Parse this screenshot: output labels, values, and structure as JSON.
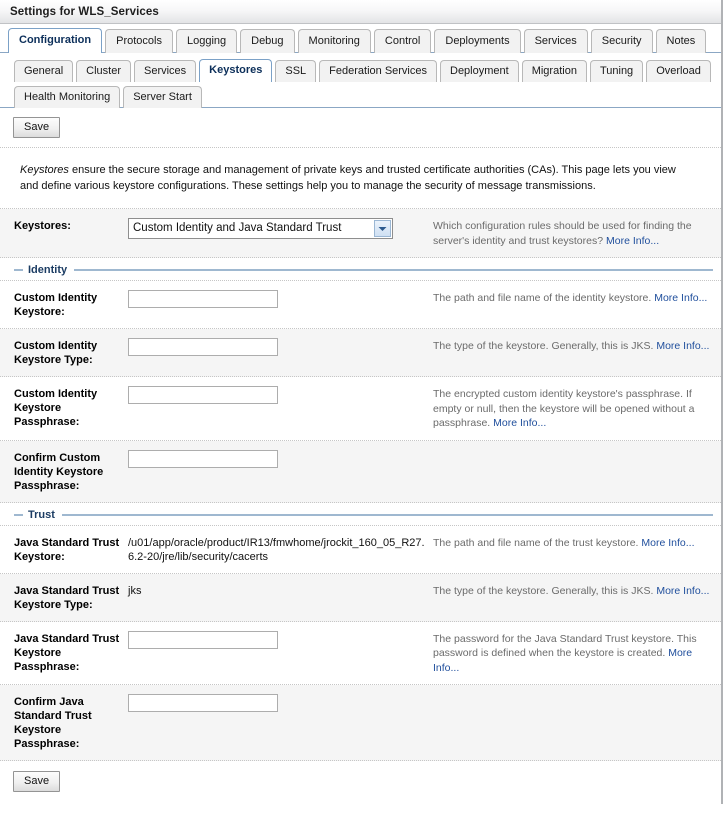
{
  "header": {
    "title": "Settings for WLS_Services"
  },
  "tabs_level1": [
    {
      "label": "Configuration",
      "active": true
    },
    {
      "label": "Protocols",
      "active": false
    },
    {
      "label": "Logging",
      "active": false
    },
    {
      "label": "Debug",
      "active": false
    },
    {
      "label": "Monitoring",
      "active": false
    },
    {
      "label": "Control",
      "active": false
    },
    {
      "label": "Deployments",
      "active": false
    },
    {
      "label": "Services",
      "active": false
    },
    {
      "label": "Security",
      "active": false
    },
    {
      "label": "Notes",
      "active": false
    }
  ],
  "tabs_level2": [
    {
      "label": "General",
      "active": false
    },
    {
      "label": "Cluster",
      "active": false
    },
    {
      "label": "Services",
      "active": false
    },
    {
      "label": "Keystores",
      "active": true
    },
    {
      "label": "SSL",
      "active": false
    },
    {
      "label": "Federation Services",
      "active": false
    },
    {
      "label": "Deployment",
      "active": false
    },
    {
      "label": "Migration",
      "active": false
    },
    {
      "label": "Tuning",
      "active": false
    },
    {
      "label": "Overload",
      "active": false
    }
  ],
  "tabs_level3": [
    {
      "label": "Health Monitoring",
      "active": false
    },
    {
      "label": "Server Start",
      "active": false
    }
  ],
  "toolbar": {
    "save_top_label": "Save",
    "save_bottom_label": "Save"
  },
  "intro": {
    "emphasis": "Keystores",
    "text": " ensure the secure storage and management of private keys and trusted certificate authorities (CAs). This page lets you view and define various keystore configurations. These settings help you to manage the security of message transmissions."
  },
  "keystores_row": {
    "label": "Keystores:",
    "selected": "Custom Identity and Java Standard Trust",
    "help": "Which configuration rules should be used for finding the server's identity and trust keystores?",
    "more_info": "More Info..."
  },
  "sections": {
    "identity": "Identity",
    "trust": "Trust"
  },
  "identity_rows": [
    {
      "label": "Custom Identity Keystore:",
      "value": "",
      "placeholder": "",
      "help": "The path and file name of the identity keystore.",
      "more_info": "More Info..."
    },
    {
      "label": "Custom Identity Keystore Type:",
      "value": "",
      "placeholder": "",
      "help": "The type of the keystore. Generally, this is JKS.",
      "more_info": "More Info..."
    },
    {
      "label": "Custom Identity Keystore Passphrase:",
      "value": "",
      "placeholder": "",
      "help": "The encrypted custom identity keystore's passphrase. If empty or null, then the keystore will be opened without a passphrase.",
      "more_info": "More Info..."
    },
    {
      "label": "Confirm Custom Identity Keystore Passphrase:",
      "value": "",
      "placeholder": "",
      "help": "",
      "more_info": ""
    }
  ],
  "trust_rows": [
    {
      "label": "Java Standard Trust Keystore:",
      "readonly_value": "/u01/app/oracle/product/IR13/fmwhome/jrockit_160_05_R27.6.2-20/jre/lib/security/cacerts",
      "help": "The path and file name of the trust keystore.",
      "more_info": "More Info..."
    },
    {
      "label": "Java Standard Trust Keystore Type:",
      "readonly_value": "jks",
      "help": "The type of the keystore. Generally, this is JKS.",
      "more_info": "More Info..."
    },
    {
      "label": "Java Standard Trust Keystore Passphrase:",
      "value": "",
      "placeholder": "",
      "help": "The password for the Java Standard Trust keystore. This password is defined when the keystore is created.",
      "more_info": "More Info..."
    },
    {
      "label": "Confirm Java Standard Trust Keystore Passphrase:",
      "value": "",
      "placeholder": "",
      "help": "",
      "more_info": ""
    }
  ],
  "colors": {
    "accent_blue": "#1f4e9c",
    "section_rule": "#9fb8d0",
    "section_title": "#1b3c63",
    "alt_row": "#f5f5f5",
    "help_text": "#6b6b6b"
  }
}
